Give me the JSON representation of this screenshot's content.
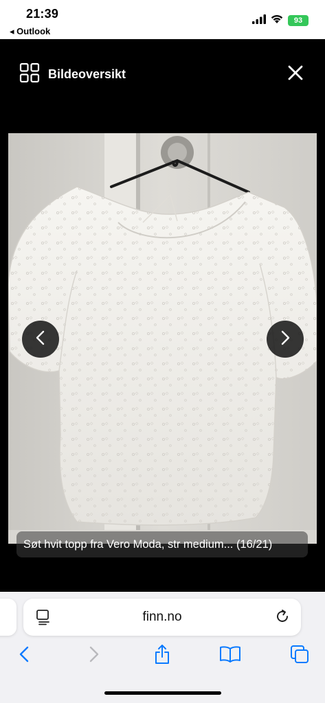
{
  "status_bar": {
    "time": "21:39",
    "back_app": "◂ Outlook",
    "battery": "93"
  },
  "viewer": {
    "overview_label": "Bildeoversikt",
    "caption": "Søt hvit topp fra Vero Moda, str medium... (16/21)"
  },
  "browser": {
    "url": "finn.no"
  },
  "colors": {
    "battery_green": "#34c759",
    "toolbar_blue": "#0a7aff"
  }
}
